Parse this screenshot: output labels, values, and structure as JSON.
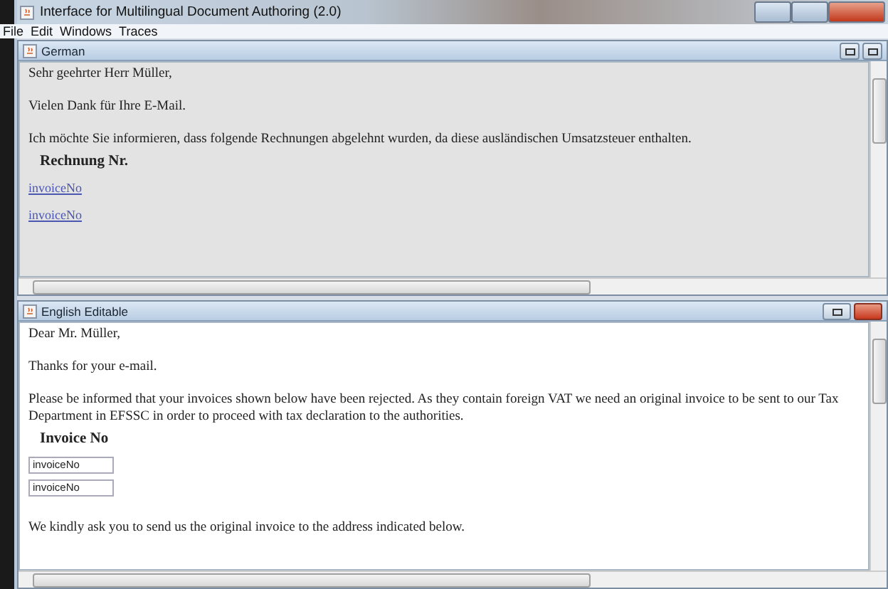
{
  "window": {
    "title": "Interface for Multilingual Document Authoring (2.0)"
  },
  "menu": [
    {
      "label": "File"
    },
    {
      "label": "Edit"
    },
    {
      "label": "Windows"
    },
    {
      "label": "Traces"
    }
  ],
  "panes": [
    {
      "title": "German",
      "editable": false,
      "buttons": [
        {
          "kind": "restore"
        },
        {
          "kind": "maximize"
        }
      ],
      "content": [
        {
          "kind": "paragraph",
          "text": "Sehr geehrter Herr Müller,"
        },
        {
          "kind": "paragraph",
          "text": "Vielen Dank für Ihre E-Mail."
        },
        {
          "kind": "paragraph",
          "text": "Ich möchte Sie informieren, dass folgende Rechnungen abgelehnt wurden, da diese ausländischen Umsatzsteuer enthalten."
        },
        {
          "kind": "heading",
          "text": "Rechnung Nr."
        },
        {
          "kind": "link",
          "text": "invoiceNo"
        },
        {
          "kind": "link",
          "text": "invoiceNo"
        }
      ]
    },
    {
      "title": "English Editable",
      "editable": true,
      "buttons": [
        {
          "kind": "restore"
        },
        {
          "kind": "close"
        }
      ],
      "content": [
        {
          "kind": "paragraph",
          "text": "Dear Mr. Müller,"
        },
        {
          "kind": "paragraph",
          "text": "Thanks for your e-mail."
        },
        {
          "kind": "paragraph",
          "text": "Please be informed that your invoices shown below have been rejected. As they contain foreign VAT we need an original invoice to be sent to our Tax Department in EFSSC in order to proceed with tax declaration to the authorities."
        },
        {
          "kind": "heading",
          "text": "Invoice No"
        },
        {
          "kind": "field",
          "value": "invoiceNo"
        },
        {
          "kind": "field",
          "value": "invoiceNo"
        },
        {
          "kind": "paragraph",
          "text": "We kindly ask you to send us the original invoice to the address indicated below."
        }
      ]
    }
  ]
}
